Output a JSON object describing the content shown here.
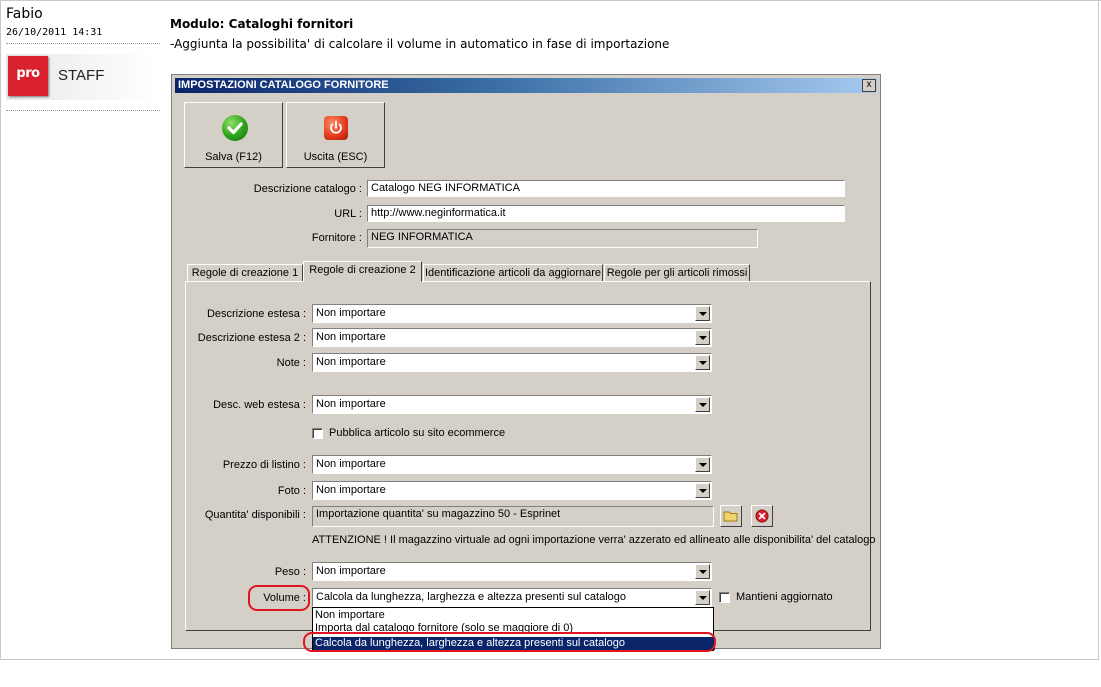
{
  "post": {
    "author": "Fabio",
    "date": "26/10/2011 14:31",
    "logo": {
      "mark": "pro",
      "text": "STAFF",
      "color": "#d8202e"
    },
    "title": "Modulo: Cataloghi fornitori",
    "body": "-Aggiunta la possibilita' di calcolare il volume in automatico in fase di importazione"
  },
  "dialog": {
    "title": "IMPOSTAZIONI CATALOGO FORNITORE",
    "close_label": "x",
    "toolbar": {
      "save": {
        "label": "Salva (F12)",
        "icon": "check-icon"
      },
      "exit": {
        "label": "Uscita (ESC)",
        "icon": "power-icon"
      }
    },
    "fields": {
      "descrizione_label": "Descrizione catalogo :",
      "descrizione_value": "Catalogo NEG INFORMATICA",
      "url_label": "URL :",
      "url_value": "http://www.neginformatica.it",
      "fornitore_label": "Fornitore :",
      "fornitore_value": "NEG INFORMATICA"
    },
    "tabs": [
      {
        "label": "Regole di creazione 1",
        "active": false
      },
      {
        "label": "Regole di creazione 2",
        "active": true
      },
      {
        "label": "Identificazione articoli da aggiornare",
        "active": false
      },
      {
        "label": "Regole per gli articoli rimossi",
        "active": false
      }
    ],
    "rules": {
      "descrizione_estesa": {
        "label": "Descrizione estesa :",
        "value": "Non importare"
      },
      "descrizione_estesa_2": {
        "label": "Descrizione estesa 2 :",
        "value": "Non importare"
      },
      "note": {
        "label": "Note :",
        "value": "Non importare"
      },
      "desc_web": {
        "label": "Desc. web estesa :",
        "value": "Non importare"
      },
      "pubblica": {
        "label": "Pubblica articolo su sito ecommerce",
        "checked": false
      },
      "prezzo": {
        "label": "Prezzo di listino :",
        "value": "Non importare"
      },
      "foto": {
        "label": "Foto :",
        "value": "Non importare"
      },
      "quantita": {
        "label": "Quantita' disponibili :",
        "value": "Importazione quantita' su magazzino 50 - Esprinet"
      },
      "attenzione": "ATTENZIONE ! Il magazzino virtuale ad ogni importazione verra' azzerato ed allineato alle disponibilita' del catalogo",
      "peso": {
        "label": "Peso :",
        "value": "Non importare"
      },
      "volume": {
        "label": "Volume :",
        "value": "Calcola da lunghezza, larghezza e altezza presenti sul catalogo"
      },
      "mantieni": {
        "label": "Mantieni aggiornato",
        "checked": false
      }
    },
    "volume_options": [
      "Non importare",
      "Importa dal catalogo fornitore (solo se maggiore di 0)",
      "Calcola da lunghezza, larghezza e altezza presenti sul catalogo"
    ],
    "highlight_color": "#e0141e",
    "selection_color": "#0a246a"
  }
}
